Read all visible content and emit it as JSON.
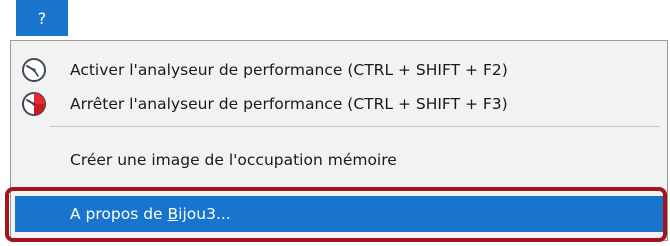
{
  "menubar": {
    "help_label": "?"
  },
  "menu": {
    "items": [
      {
        "label": "Activer l'analyseur de performance (CTRL + SHIFT + F2)",
        "icon": "performance-analyzer-icon"
      },
      {
        "label": "Arrêter l'analyseur de performance (CTRL + SHIFT + F3)",
        "icon": "stop-performance-analyzer-icon"
      },
      {
        "label": "Créer une image de l'occupation mémoire"
      },
      {
        "label_prefix": "A propos de ",
        "label_mnemonic": "B",
        "label_suffix": "ijou3...",
        "highlighted": true
      }
    ]
  },
  "colors": {
    "accent": "#1874cd",
    "annotation": "#a3141b",
    "menu_background": "#f2f2f2"
  }
}
